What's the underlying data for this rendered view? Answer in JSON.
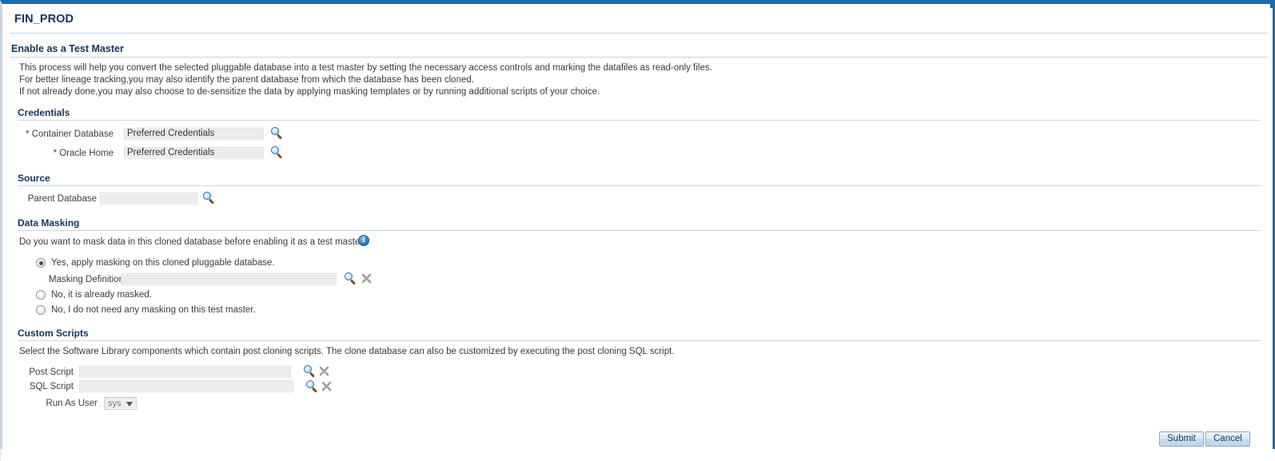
{
  "window": {
    "title": "FIN_PROD",
    "accent_color": "#1b6cb0",
    "heading_color": "#16335b"
  },
  "page": {
    "subheading": "Enable as a Test Master",
    "intro_lines": [
      "This process will help you convert the selected pluggable database into a test master by setting the necessary access controls and marking the datafiles as read-only files.",
      "For better lineage tracking,you may also identify the parent database from which the database has been cloned.",
      "If not already done,you may also choose to de-sensitize the data by applying masking templates or by running additional scripts of your choice."
    ]
  },
  "credentials": {
    "section_title": "Credentials",
    "fields": [
      {
        "label": "* Container Database",
        "value": "Preferred Credentials",
        "search_icon": "search-icon"
      },
      {
        "label": "* Oracle Home",
        "value": "Preferred Credentials",
        "search_icon": "search-icon"
      }
    ]
  },
  "source": {
    "section_title": "Source",
    "fields": [
      {
        "label": "Parent Database",
        "value": "",
        "search_icon": "search-icon"
      }
    ]
  },
  "data_masking": {
    "section_title": "Data Masking",
    "question": "Do you want to mask data in this cloned database before enabling it as a test master?",
    "info_icon": "info-icon",
    "info_glyph": "i",
    "options": [
      {
        "label": "Yes, apply masking on this cloned pluggable database.",
        "selected": true
      },
      {
        "label": "No, it is already masked.",
        "selected": false
      },
      {
        "label": "No, I do not need any masking on this test master.",
        "selected": false
      }
    ],
    "masking_definition": {
      "label": "Masking Definition",
      "value": "",
      "search_icon": "search-icon",
      "clear_icon": "clear-icon"
    }
  },
  "custom_scripts": {
    "section_title": "Custom Scripts",
    "description": "Select the Software Library components which contain post cloning scripts. The clone database can also be customized by executing the post cloning SQL script.",
    "fields": [
      {
        "label": "Post Script",
        "value": "",
        "search_icon": "search-icon",
        "clear_icon": "clear-icon"
      },
      {
        "label": "SQL Script",
        "value": "",
        "search_icon": "search-icon",
        "clear_icon": "clear-icon"
      }
    ],
    "run_as_user": {
      "label": "Run As User",
      "value": "sys",
      "options": [
        "sys"
      ]
    }
  },
  "actions": {
    "submit_label": "Submit",
    "cancel_label": "Cancel"
  }
}
